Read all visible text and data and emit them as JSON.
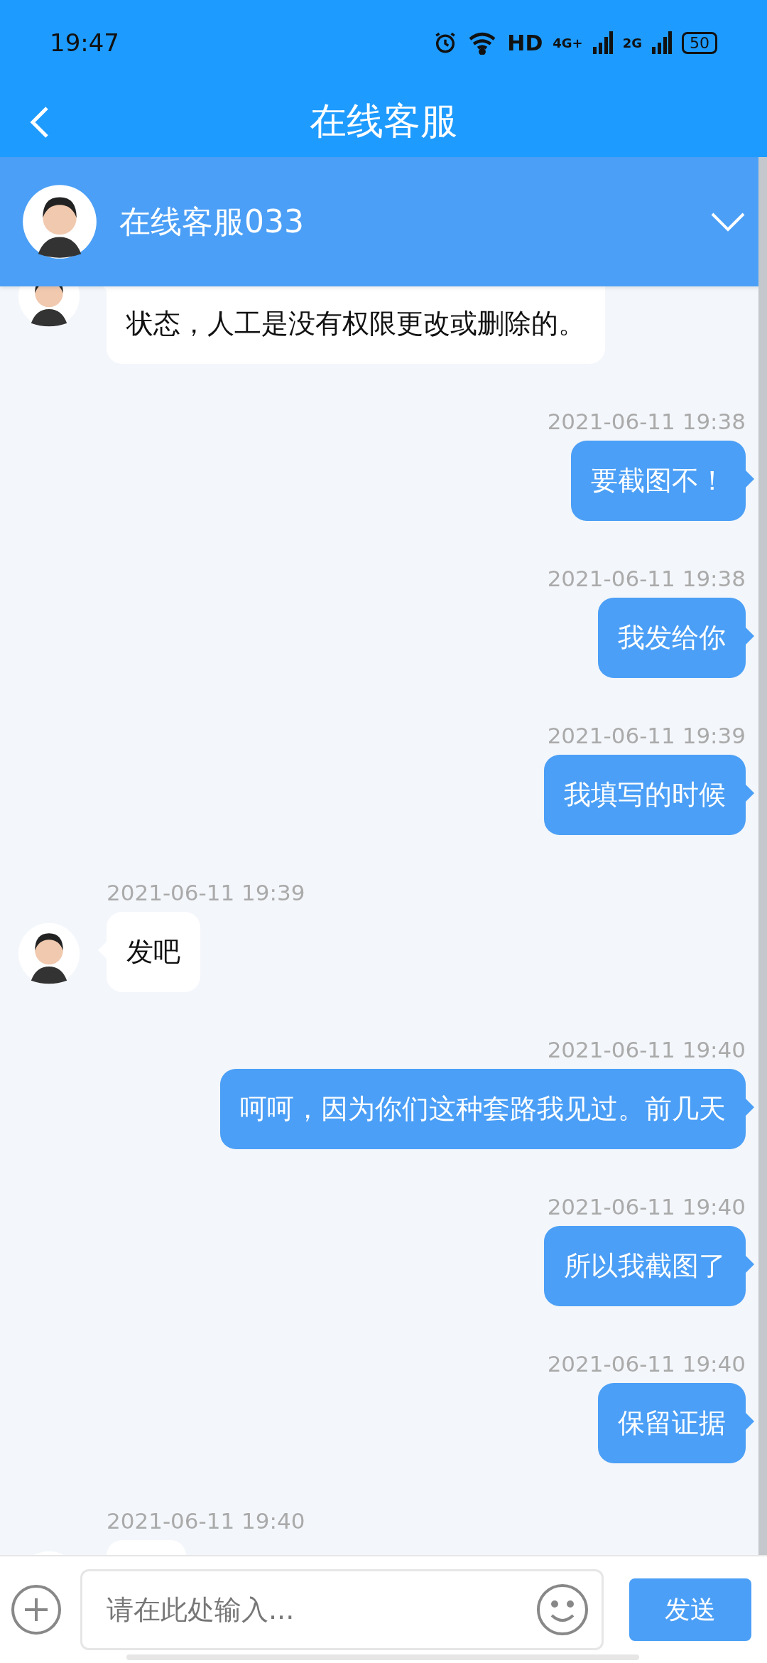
{
  "status_bar": {
    "time": "19:47",
    "hd": "HD",
    "networks": [
      "4G+",
      "2G"
    ],
    "battery": "50"
  },
  "header": {
    "title": "在线客服"
  },
  "agent": {
    "name": "在线客服033"
  },
  "messages": [
    {
      "kind": "agent",
      "text": "状态，人工是没有权限更改或删除的。"
    },
    {
      "kind": "user",
      "time": "2021-06-11 19:38",
      "text": "要截图不！"
    },
    {
      "kind": "user",
      "time": "2021-06-11 19:38",
      "text": "我发给你"
    },
    {
      "kind": "user",
      "time": "2021-06-11 19:39",
      "text": "我填写的时候"
    },
    {
      "kind": "agent",
      "time": "2021-06-11 19:39",
      "text": "发吧"
    },
    {
      "kind": "user",
      "time": "2021-06-11 19:40",
      "text": "呵呵，因为你们这种套路我见过。前几天"
    },
    {
      "kind": "user",
      "time": "2021-06-11 19:40",
      "text": "所以我截图了"
    },
    {
      "kind": "user",
      "time": "2021-06-11 19:40",
      "text": "保留证据"
    },
    {
      "kind": "agent",
      "time": "2021-06-11 19:40"
    }
  ],
  "input": {
    "placeholder": "请在此处输入...",
    "send": "发送"
  }
}
